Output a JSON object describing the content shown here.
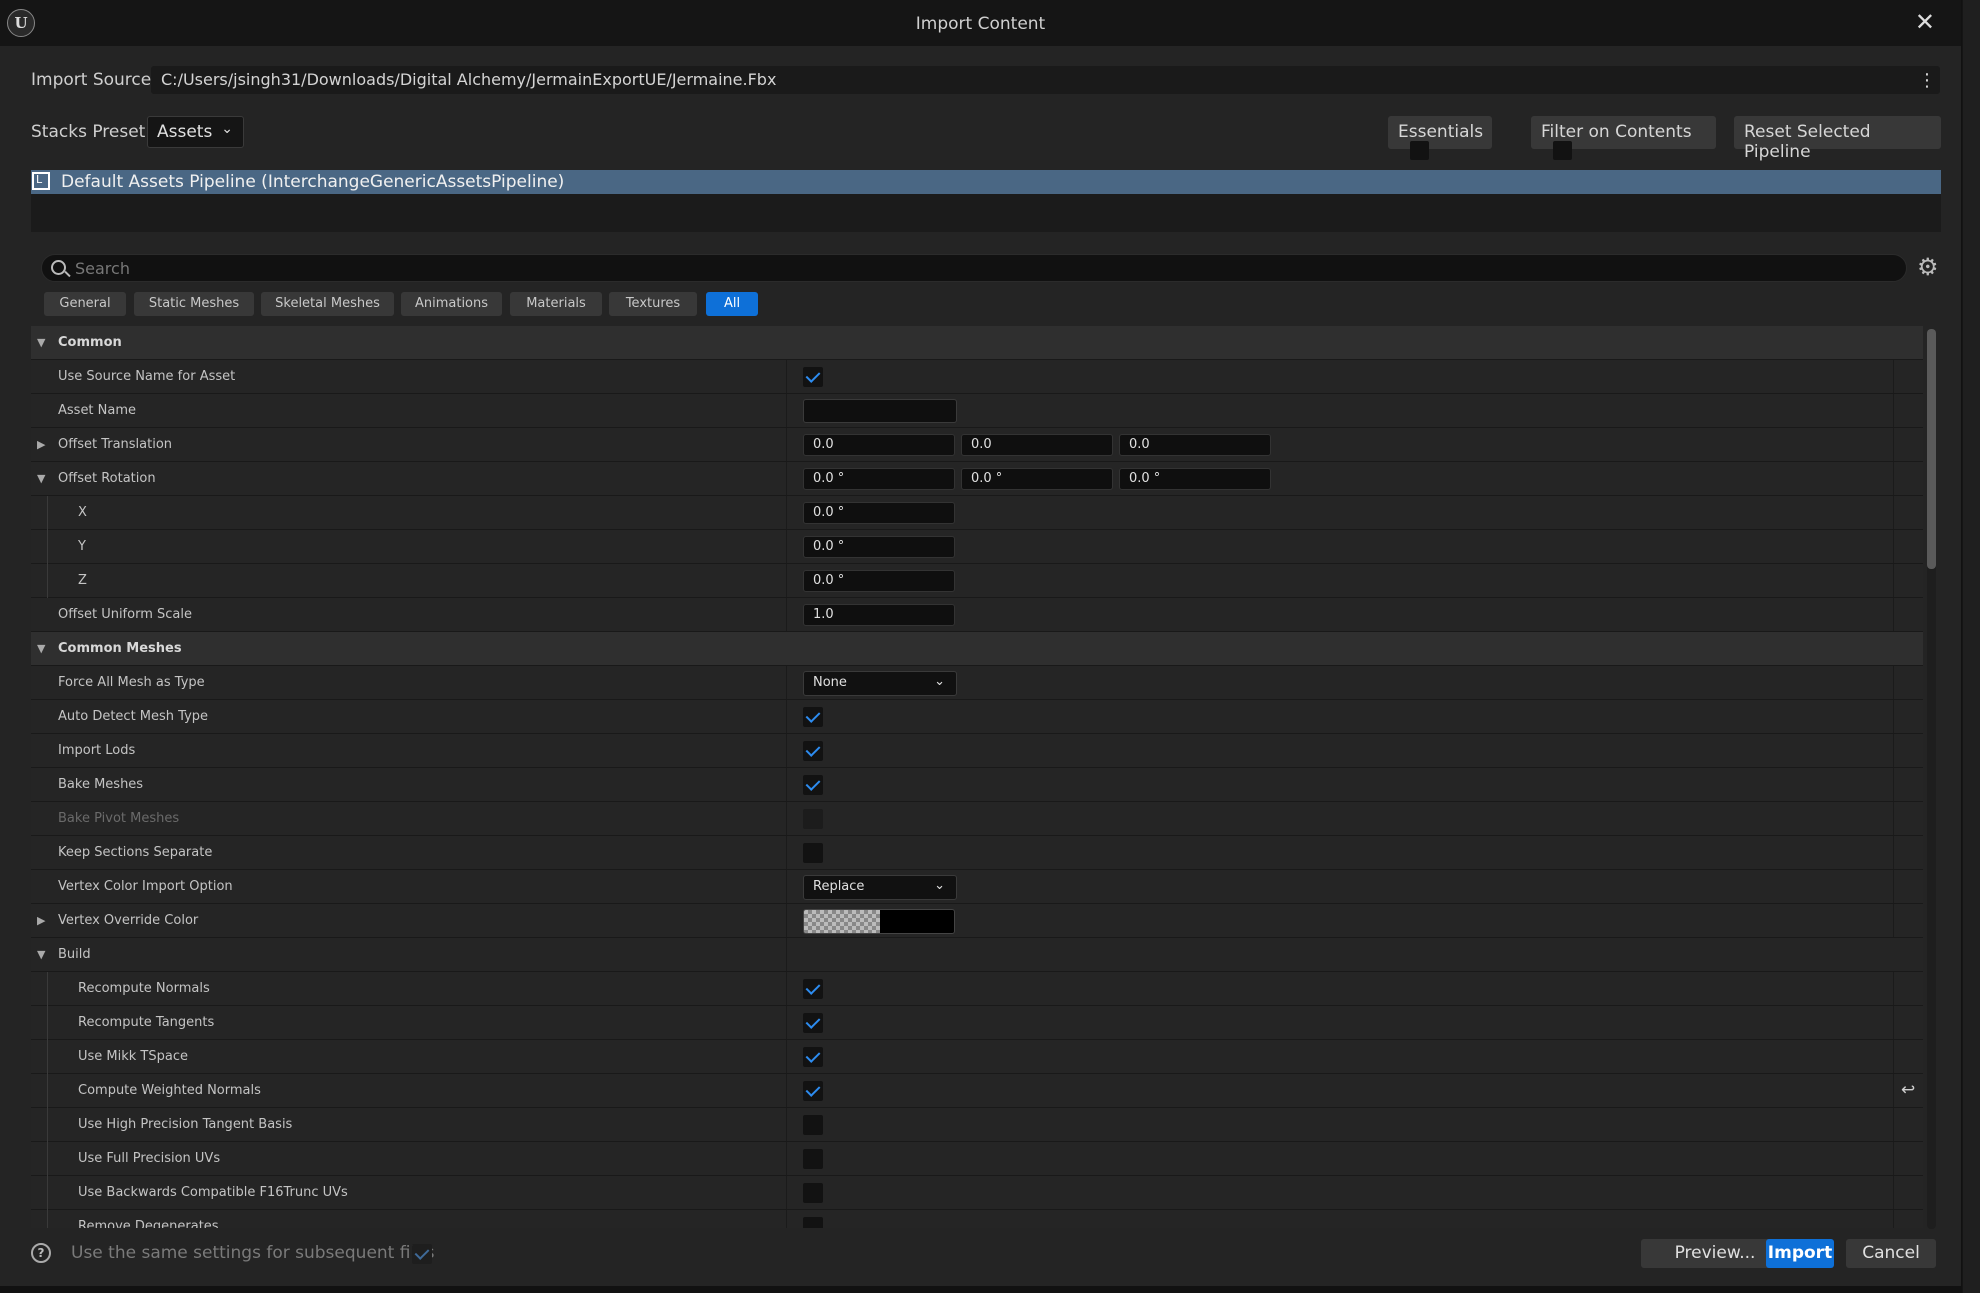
{
  "window": {
    "title": "Import Content",
    "logo_text": "U"
  },
  "import_source": {
    "label": "Import Source",
    "path": "C:/Users/jsingh31/Downloads/Digital Alchemy/JermainExportUE/Jermaine.Fbx"
  },
  "stacks": {
    "label": "Stacks Preset",
    "value": "Assets"
  },
  "toolbar": {
    "essentials_label": "Essentials",
    "filter_label": "Filter on Contents",
    "reset_label": "Reset Selected Pipeline"
  },
  "pipeline": {
    "name": "Default Assets Pipeline (InterchangeGenericAssetsPipeline)"
  },
  "search": {
    "placeholder": "Search"
  },
  "tabs": [
    "General",
    "Static Meshes",
    "Skeletal Meshes",
    "Animations",
    "Materials",
    "Textures",
    "All"
  ],
  "active_tab": "All",
  "properties": {
    "common": "Common",
    "use_source_name": "Use Source Name for Asset",
    "asset_name": "Asset Name",
    "offset_translation": "Offset Translation",
    "offset_translation_values": [
      "0.0",
      "0.0",
      "0.0"
    ],
    "offset_rotation": "Offset Rotation",
    "offset_rotation_values": [
      "0.0 °",
      "0.0 °",
      "0.0 °"
    ],
    "x": "X",
    "x_value": "0.0 °",
    "y": "Y",
    "y_value": "0.0 °",
    "z": "Z",
    "z_value": "0.0 °",
    "offset_uniform_scale": "Offset Uniform Scale",
    "offset_uniform_scale_value": "1.0",
    "common_meshes": "Common Meshes",
    "force_all_mesh": "Force All Mesh as Type",
    "force_all_mesh_value": "None",
    "auto_detect": "Auto Detect Mesh Type",
    "import_lods": "Import Lods",
    "bake_meshes": "Bake Meshes",
    "bake_pivot": "Bake Pivot Meshes",
    "keep_sections": "Keep Sections Separate",
    "vertex_color_option": "Vertex Color Import Option",
    "vertex_color_option_value": "Replace",
    "vertex_override_color": "Vertex Override Color",
    "build": "Build",
    "recompute_normals": "Recompute Normals",
    "recompute_tangents": "Recompute Tangents",
    "use_mikk": "Use Mikk TSpace",
    "compute_weighted": "Compute Weighted Normals",
    "high_precision": "Use High Precision Tangent Basis",
    "full_precision_uvs": "Use Full Precision UVs",
    "backwards_compat": "Use Backwards Compatible F16Trunc UVs",
    "remove_degenerates": "Remove Degenerates"
  },
  "footer": {
    "same_settings": "Use the same settings for subsequent files",
    "preview": "Preview...",
    "import": "Import",
    "cancel": "Cancel",
    "help_glyph": "?"
  },
  "colors": {
    "accent": "#0e70d8",
    "pipeline_highlight": "#4a6784",
    "checkmark": "#2d8cf0"
  },
  "icons": [
    "unreal-logo-icon",
    "close-icon",
    "kebab-menu-icon",
    "chevron-down-icon",
    "search-icon",
    "gear-icon",
    "pipeline-icon",
    "expand-arrow-icon",
    "collapse-arrow-icon",
    "reset-to-default-icon",
    "help-icon"
  ]
}
